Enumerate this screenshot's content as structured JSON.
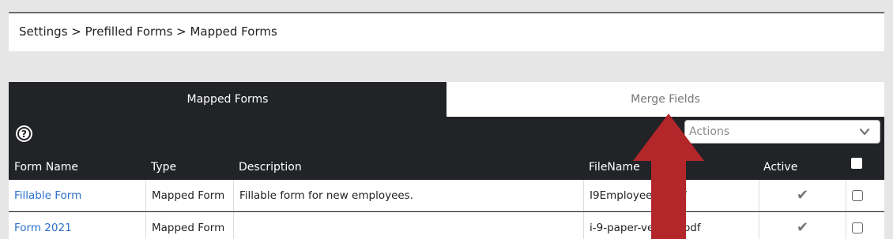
{
  "breadcrumb": "Settings > Prefilled Forms > Mapped Forms",
  "tabs": [
    {
      "label": "Mapped Forms",
      "active": true
    },
    {
      "label": "Merge Fields",
      "active": false
    }
  ],
  "help_icon": "question-circle-icon",
  "actions": {
    "placeholder": "Actions"
  },
  "table": {
    "columns": [
      "Form Name",
      "Type",
      "Description",
      "FileName",
      "Active"
    ],
    "rows": [
      {
        "form_name": "Fillable Form",
        "type": "Mapped Form",
        "description": "Fillable form for new employees.",
        "file_name": "I9Employee22.pdf",
        "active": true
      },
      {
        "form_name": "Form 2021",
        "type": "Mapped Form",
        "description": "",
        "file_name": "i-9-paper-version.pdf",
        "active": true
      }
    ]
  },
  "annotation": {
    "icon": "red-up-arrow-icon",
    "color": "#b3262a"
  },
  "colors": {
    "header_bg": "#212326",
    "link": "#2a6fc9"
  }
}
